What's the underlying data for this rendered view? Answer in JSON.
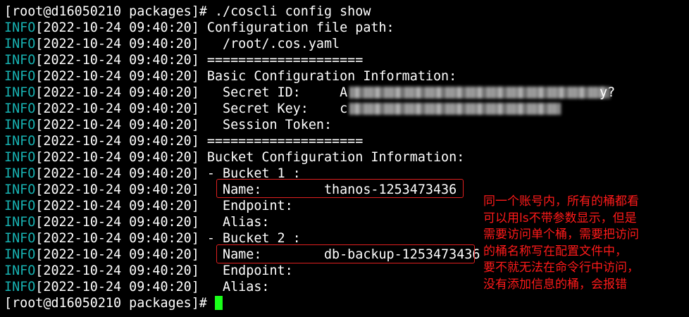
{
  "terminal": {
    "lines": [
      {
        "kind": "prompt",
        "text": "[root@d16050210 packages]# ./coscli config show"
      },
      {
        "kind": "log",
        "level": "INFO",
        "ts": "[2022-10-24 09:40:20]",
        "msg": " Configuration file path:"
      },
      {
        "kind": "log",
        "level": "INFO",
        "ts": "[2022-10-24 09:40:20]",
        "msg": "   /root/.cos.yaml"
      },
      {
        "kind": "log",
        "level": "INFO",
        "ts": "[2022-10-24 09:40:20]",
        "msg": " ===================="
      },
      {
        "kind": "log",
        "level": "INFO",
        "ts": "[2022-10-24 09:40:20]",
        "msg": " Basic Configuration Information:"
      },
      {
        "kind": "log",
        "level": "INFO",
        "ts": "[2022-10-24 09:40:20]",
        "msg": "   Secret ID:     A",
        "redacted": "id",
        "tail": "y?"
      },
      {
        "kind": "log",
        "level": "INFO",
        "ts": "[2022-10-24 09:40:20]",
        "msg": "   Secret Key:    c",
        "redacted": "key"
      },
      {
        "kind": "log",
        "level": "INFO",
        "ts": "[2022-10-24 09:40:20]",
        "msg": "   Session Token:"
      },
      {
        "kind": "log",
        "level": "INFO",
        "ts": "[2022-10-24 09:40:20]",
        "msg": " ===================="
      },
      {
        "kind": "log",
        "level": "INFO",
        "ts": "[2022-10-24 09:40:20]",
        "msg": " Bucket Configuration Information:"
      },
      {
        "kind": "log",
        "level": "INFO",
        "ts": "[2022-10-24 09:40:20]",
        "msg": " - Bucket 1 :"
      },
      {
        "kind": "log",
        "level": "INFO",
        "ts": "[2022-10-24 09:40:20]",
        "msg": "   Name:        thanos-1253473436"
      },
      {
        "kind": "log",
        "level": "INFO",
        "ts": "[2022-10-24 09:40:20]",
        "msg": "   Endpoint:"
      },
      {
        "kind": "log",
        "level": "INFO",
        "ts": "[2022-10-24 09:40:20]",
        "msg": "   Alias:"
      },
      {
        "kind": "log",
        "level": "INFO",
        "ts": "[2022-10-24 09:40:20]",
        "msg": " - Bucket 2 :"
      },
      {
        "kind": "log",
        "level": "INFO",
        "ts": "[2022-10-24 09:40:20]",
        "msg": "   Name:        db-backup-1253473436"
      },
      {
        "kind": "log",
        "level": "INFO",
        "ts": "[2022-10-24 09:40:20]",
        "msg": "   Endpoint:"
      },
      {
        "kind": "log",
        "level": "INFO",
        "ts": "[2022-10-24 09:40:20]",
        "msg": "   Alias:"
      },
      {
        "kind": "prompt",
        "text": "[root@d16050210 packages]# ",
        "cursor": true
      }
    ]
  },
  "annotation": {
    "color": "#ff1a1a",
    "lines": [
      "同一个账号内，所有的桶都看",
      "可以用ls不带参数显示，但是",
      "需要访问单个桶，需要把访问",
      "的桶名称写在配置文件中，",
      "要不就无法在命令行中访问，",
      "没有添加信息的桶，会报错"
    ]
  },
  "colors": {
    "background": "#000000",
    "info_level": "#17b2b2",
    "text": "#ffffff",
    "cursor": "#19ff19",
    "highlight_box": "#e02020"
  }
}
